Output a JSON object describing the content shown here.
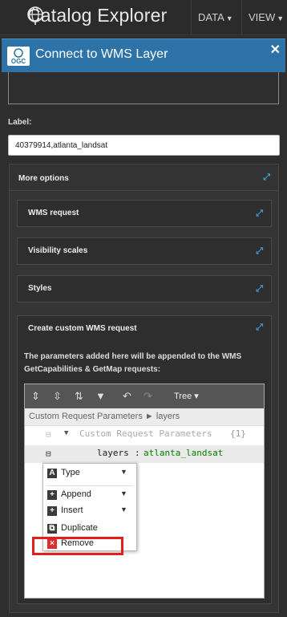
{
  "topbar": {
    "app_title": "Catalog Explorer",
    "nav": [
      {
        "label": "DATA"
      },
      {
        "label": "VIEW"
      }
    ]
  },
  "dialog": {
    "title": "Connect to WMS Layer",
    "logo_text": "OGC"
  },
  "form": {
    "label_text": "Label:",
    "label_value": "40379914,atlanta_landsat"
  },
  "more_options": {
    "title": "More options",
    "sections": [
      {
        "title": "WMS request"
      },
      {
        "title": "Visibility scales"
      },
      {
        "title": "Styles"
      },
      {
        "title": "Create custom WMS request"
      }
    ],
    "notice": "The parameters added here will be appended to the WMS GetCapabilities & GetMap requests:"
  },
  "editor": {
    "mode": "Tree",
    "path": "Custom Request Parameters ► layers",
    "root_label": "Custom Request Parameters",
    "root_count": "{1}",
    "field_key": "layers",
    "field_value": "atlanta_landsat"
  },
  "context_menu": {
    "items": [
      {
        "label": "Type",
        "icon": "type-icon",
        "glyph": "A"
      },
      {
        "label": "Append",
        "icon": "append-icon",
        "glyph": "+"
      },
      {
        "label": "Insert",
        "icon": "insert-icon",
        "glyph": "+"
      },
      {
        "label": "Duplicate",
        "icon": "duplicate-icon",
        "glyph": "⧉"
      },
      {
        "label": "Remove",
        "icon": "remove-icon",
        "glyph": "×"
      }
    ]
  },
  "colors": {
    "header": "#2d73a8",
    "accent": "#3a9ed8",
    "remove": "#d9302f",
    "highlight": "#e02020"
  }
}
